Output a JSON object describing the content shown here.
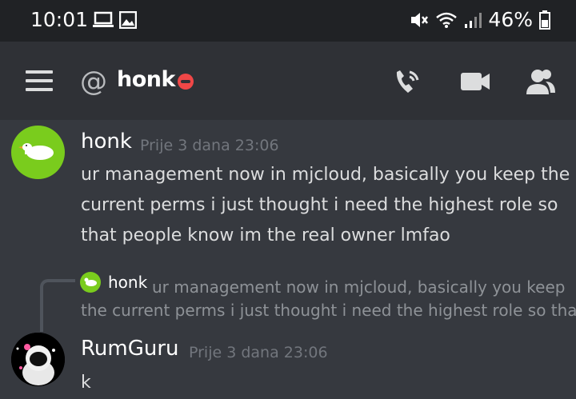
{
  "status_bar": {
    "time": "10:01",
    "battery": "46%",
    "icons": [
      "laptop-icon",
      "image-icon",
      "mute-icon",
      "wifi-icon",
      "signal-icon",
      "battery-icon"
    ]
  },
  "header": {
    "channel_prefix": "@",
    "channel_name": "honk",
    "icons": [
      "menu-icon",
      "call-icon",
      "video-icon",
      "members-icon"
    ]
  },
  "messages": [
    {
      "username": "honk",
      "timestamp": "Prije 3 dana 23:06",
      "lines": [
        "ur management now in mjcloud, basically you keep the",
        "current perms i just thought i need the highest role so",
        "that people know im the real owner lmfao"
      ]
    },
    {
      "reply": {
        "username": "honk",
        "line1": "ur management now in mjcloud, basically you keep",
        "line2": "the current perms i just thought i need the highest role so that"
      },
      "username": "RumGuru",
      "timestamp": "Prije 3 dana 23:06",
      "text": "k"
    }
  ],
  "colors": {
    "background": "#36393f",
    "header": "#2f3136",
    "statusbar": "#202225",
    "dnd": "#f04747",
    "honk_avatar": "#7acc1d"
  }
}
